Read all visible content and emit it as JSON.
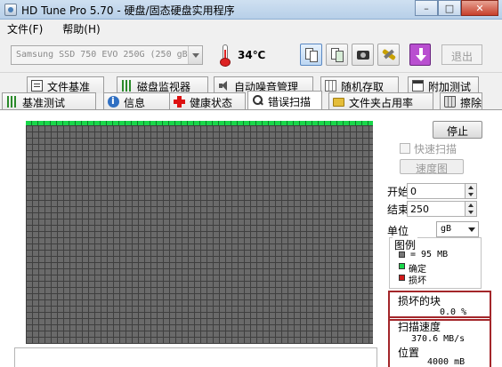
{
  "window": {
    "title": "HD Tune Pro 5.70 - 硬盘/固态硬盘实用程序",
    "minimize": "–",
    "maximize": "□",
    "close": "✕"
  },
  "menu": {
    "file": "文件(F)",
    "help": "帮助(H)"
  },
  "toolbar": {
    "drive": "Samsung SSD 750 EVO 250G (250 gB)",
    "temperature": "34℃",
    "exit_label": "退出"
  },
  "tabs": {
    "row1": [
      "文件基准",
      "磁盘监视器",
      "自动噪音管理",
      "随机存取",
      "附加测试"
    ],
    "row2": [
      "基准测试",
      "信息",
      "健康状态",
      "错误扫描",
      "文件夹占用率",
      "擦除"
    ]
  },
  "scan": {
    "stop_label": "停止",
    "quick_scan_label": "快速扫描",
    "quick_scan_checked": false,
    "speed_map_label": "速度图",
    "start_label": "开始",
    "start_value": "0",
    "end_label": "结束",
    "end_value": "250",
    "unit_label": "单位",
    "unit_value": "gB"
  },
  "legend": {
    "title": "图例",
    "block_size": "= 95 MB",
    "ok_label": "确定",
    "bad_label": "损坏"
  },
  "results": {
    "bad_blocks_label": "损坏的块",
    "bad_blocks_value": "0.0 %",
    "scan_speed_label": "扫描速度",
    "scan_speed_value": "370.6 MB/s",
    "position_label": "位置",
    "position_value": "4000 mB"
  },
  "colors": {
    "ok_block": "#19d64a",
    "bad_block": "#d11a1a",
    "unscanned_block": "#6a6a6a",
    "highlight_box": "#a3262a"
  }
}
